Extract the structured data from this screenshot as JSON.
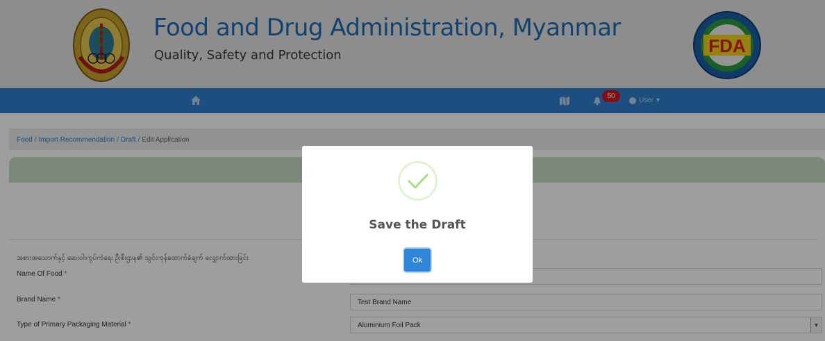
{
  "header": {
    "title": "Food and Drug Administration, Myanmar",
    "subtitle": "Quality, Safety and Protection",
    "left_logo_icon": "ministry-of-health-and-sports-logo",
    "right_logo_icon": "fda-logo",
    "right_logo_text": "FDA"
  },
  "navbar": {
    "home_icon": "home-icon",
    "map_icon": "map-icon",
    "bell_icon": "bell-icon",
    "notification_count": "50",
    "user_label": "User",
    "user_caret": "▾"
  },
  "breadcrumb": {
    "items": [
      "Food",
      "Import Recommendation",
      "Draft",
      "Edit Application"
    ],
    "separator": "/"
  },
  "form": {
    "section_title": "အစားအသောက်နှင့် ဆေးဝါးကွပ်ကဲရေး ဦးစီးဌာန၏ သွင်းကုန်ထောက်ခံချက် လျှောက်ထားခြင်း",
    "required_mark": "*",
    "fields": [
      {
        "label": "Name Of Food",
        "value": ""
      },
      {
        "label": "Brand Name",
        "value": "Test Brand Name"
      },
      {
        "label": "Type of Primary Packaging Material",
        "value": "Aluminium Foil Pack"
      }
    ]
  },
  "modal": {
    "icon": "success-check-icon",
    "title": "Save the Draft",
    "ok_label": "Ok"
  },
  "colors": {
    "title_blue": "#1e6bb3",
    "navbar_blue": "#2e7fcf",
    "badge_red": "#d7141a",
    "success_green": "#a5dc86",
    "ok_button_blue": "#2f86d8",
    "green_panel": "#c5dec5"
  }
}
